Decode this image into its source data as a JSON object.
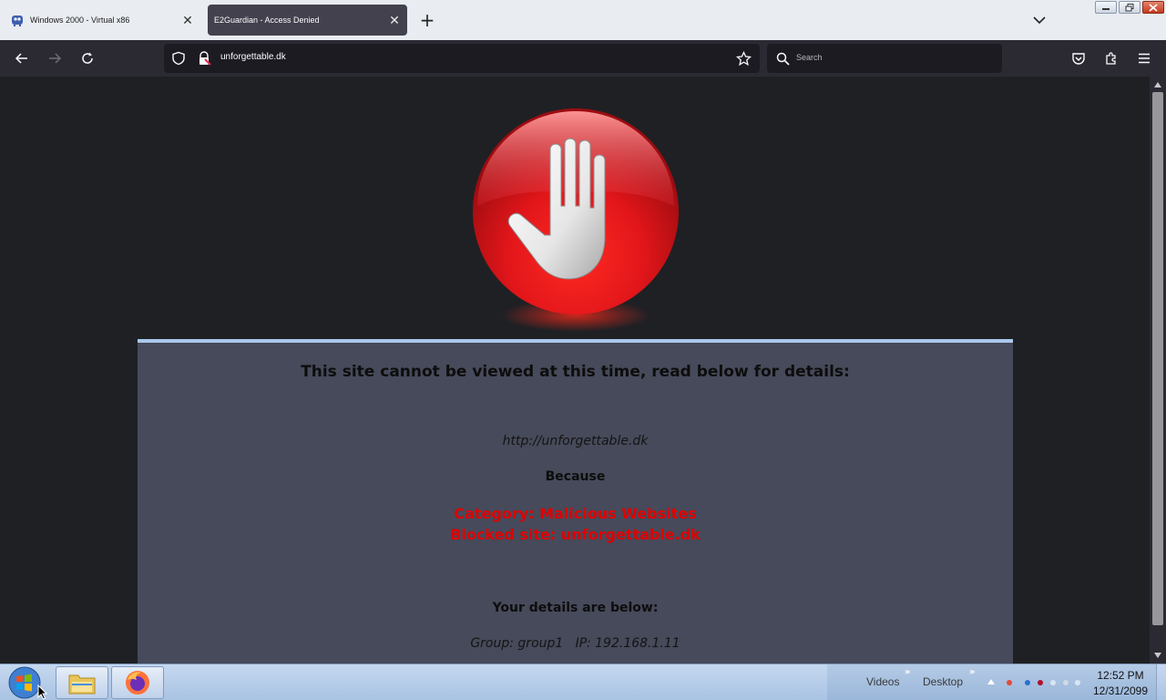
{
  "browser": {
    "tabs": [
      {
        "title": "Windows 2000 - Virtual x86",
        "active": false
      },
      {
        "title": "E2Guardian - Access Denied",
        "active": true
      }
    ],
    "address": "unforgettable.dk",
    "search_placeholder": "Search"
  },
  "page": {
    "heading": "This site cannot be viewed at this time, read below for details:",
    "blocked_url": "http://unforgettable.dk",
    "because_label": "Because",
    "reason_category": "Category: Malicious Websites",
    "reason_site": "Blocked site: unforgettable.dk",
    "details_heading": "Your details are below:",
    "details": "Group: group1   IP: 192.168.1.11"
  },
  "taskbar": {
    "toolbar_videos": "Videos",
    "toolbar_desktop": "Desktop",
    "chevron": "»",
    "time": "12:52 PM",
    "date": "12/31/2099"
  },
  "colors": {
    "page_background": "#1f2024",
    "panel_background": "#464a5a",
    "panel_border": "#a9c8ec",
    "reason_text": "#e00000",
    "browser_toolbar": "#2b2a33",
    "tabstrip": "#e9ecf1"
  }
}
